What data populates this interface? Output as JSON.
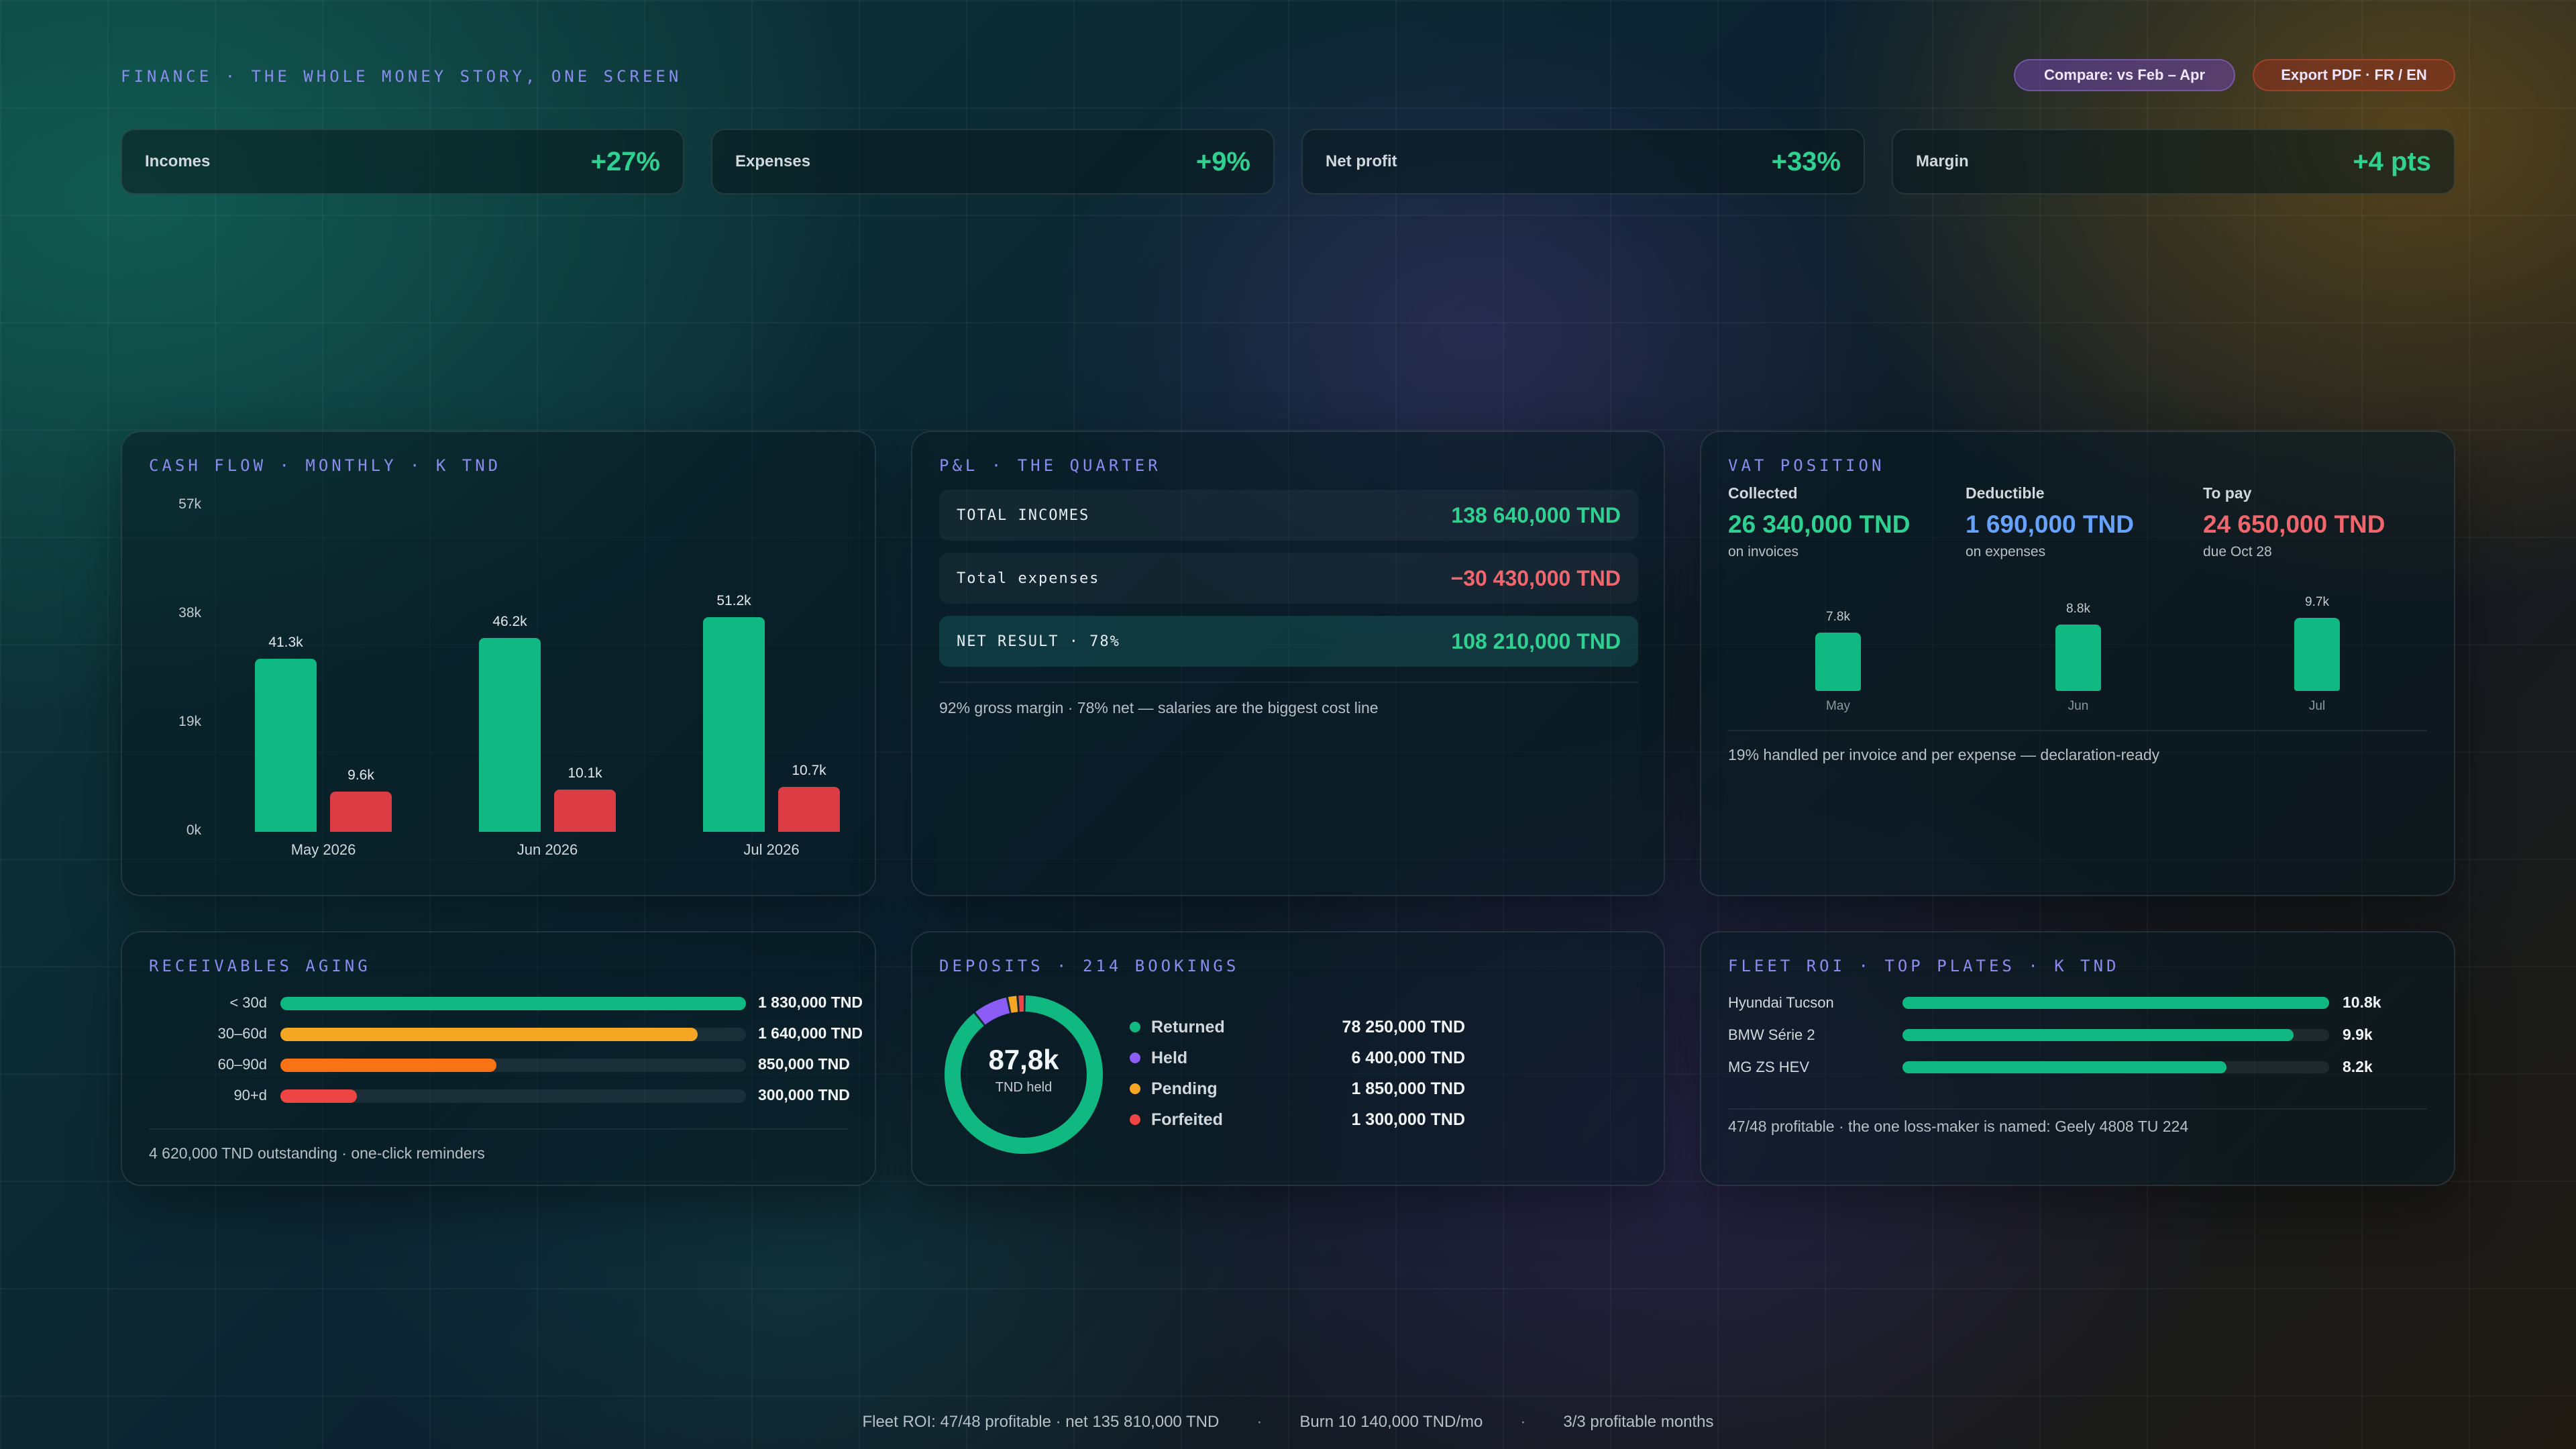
{
  "header": {
    "title": "FINANCE · THE WHOLE MONEY STORY, ONE SCREEN",
    "compare_label": "Compare: vs Feb – Apr",
    "export_label": "Export PDF · FR / EN"
  },
  "kpis": [
    {
      "label": "Incomes",
      "value": "+27%"
    },
    {
      "label": "Expenses",
      "value": "+9%"
    },
    {
      "label": "Net profit",
      "value": "+33%"
    },
    {
      "label": "Margin",
      "value": "+4 pts"
    }
  ],
  "colors": {
    "income": "#10b981",
    "expense": "#dc3c44",
    "accent": "#8b8cf0",
    "held": "#8b5cf6",
    "pending": "#f5a623",
    "forfeited": "#ef4444",
    "orange": "#f97316"
  },
  "cashflow": {
    "title": "CASH FLOW · MONTHLY · K TND",
    "y_ticks": [
      "57k",
      "38k",
      "19k",
      "0k"
    ]
  },
  "chart_data": {
    "type": "bar",
    "title": "CASH FLOW · MONTHLY · K TND",
    "categories": [
      "May 2026",
      "Jun 2026",
      "Jul 2026"
    ],
    "series": [
      {
        "values": [
          41.3,
          46.2,
          51.2
        ],
        "labels": [
          "41.3k",
          "46.2k",
          "51.2k"
        ]
      },
      {
        "values": [
          9.6,
          10.1,
          10.7
        ],
        "labels": [
          "9.6k",
          "10.1k",
          "10.7k"
        ]
      }
    ],
    "ylim": [
      0,
      57
    ],
    "grid": false
  },
  "pl": {
    "title": "P&L · THE QUARTER",
    "rows": [
      {
        "label": "TOTAL INCOMES",
        "value": "138 640,000 TND"
      },
      {
        "label": "Total expenses",
        "value": "−30 430,000 TND"
      },
      {
        "label": "NET RESULT · 78%",
        "value": "108 210,000 TND"
      }
    ],
    "note": "92% gross margin · 78% net — salaries are the biggest cost line"
  },
  "vat": {
    "title": "VAT POSITION",
    "columns": [
      {
        "label": "Collected",
        "value": "26 340,000 TND",
        "sub": "on invoices"
      },
      {
        "label": "Deductible",
        "value": "1 690,000 TND",
        "sub": "on expenses"
      },
      {
        "label": "To pay",
        "value": "24 650,000 TND",
        "sub": "due Oct 28"
      }
    ],
    "bars": [
      {
        "label": "7.8k",
        "month": "May",
        "value": 7.8
      },
      {
        "label": "8.8k",
        "month": "Jun",
        "value": 8.8
      },
      {
        "label": "9.7k",
        "month": "Jul",
        "value": 9.7
      }
    ],
    "note": "19% handled per invoice and per expense — declaration-ready"
  },
  "aging": {
    "title": "RECEIVABLES AGING",
    "rows": [
      {
        "label": "< 30d",
        "value": "1 830,000 TND",
        "fraction": 1.0
      },
      {
        "label": "30–60d",
        "value": "1 640,000 TND",
        "fraction": 0.896
      },
      {
        "label": "60–90d",
        "value": "850,000 TND",
        "fraction": 0.464
      },
      {
        "label": "90+d",
        "value": "300,000 TND",
        "fraction": 0.164
      }
    ],
    "note": "4 620,000 TND outstanding · one-click reminders"
  },
  "deposits": {
    "title": "DEPOSITS · 214 BOOKINGS",
    "center_value": "87,8k",
    "center_sub": "TND held",
    "items": [
      {
        "name": "Returned",
        "value": "78 250,000 TND",
        "amount": 78250
      },
      {
        "name": "Held",
        "value": "6 400,000 TND",
        "amount": 6400
      },
      {
        "name": "Pending",
        "value": "1 850,000 TND",
        "amount": 1850
      },
      {
        "name": "Forfeited",
        "value": "1 300,000 TND",
        "amount": 1300
      }
    ]
  },
  "fleet": {
    "title": "FLEET ROI · TOP PLATES · K TND",
    "rows": [
      {
        "label": "Hyundai Tucson",
        "value": "10.8k",
        "amount": 10.8
      },
      {
        "label": "BMW Série 2",
        "value": "9.9k",
        "amount": 9.9
      },
      {
        "label": "MG ZS HEV",
        "value": "8.2k",
        "amount": 8.2
      }
    ],
    "note": "47/48 profitable · the one loss-maker is named: Geely 4808 TU 224"
  },
  "footer": {
    "fleet": "Fleet ROI: 47/48 profitable · net 135 810,000 TND",
    "sep1": "·",
    "burn": "Burn 10 140,000 TND/mo",
    "sep2": "·",
    "months": "3/3 profitable months"
  }
}
